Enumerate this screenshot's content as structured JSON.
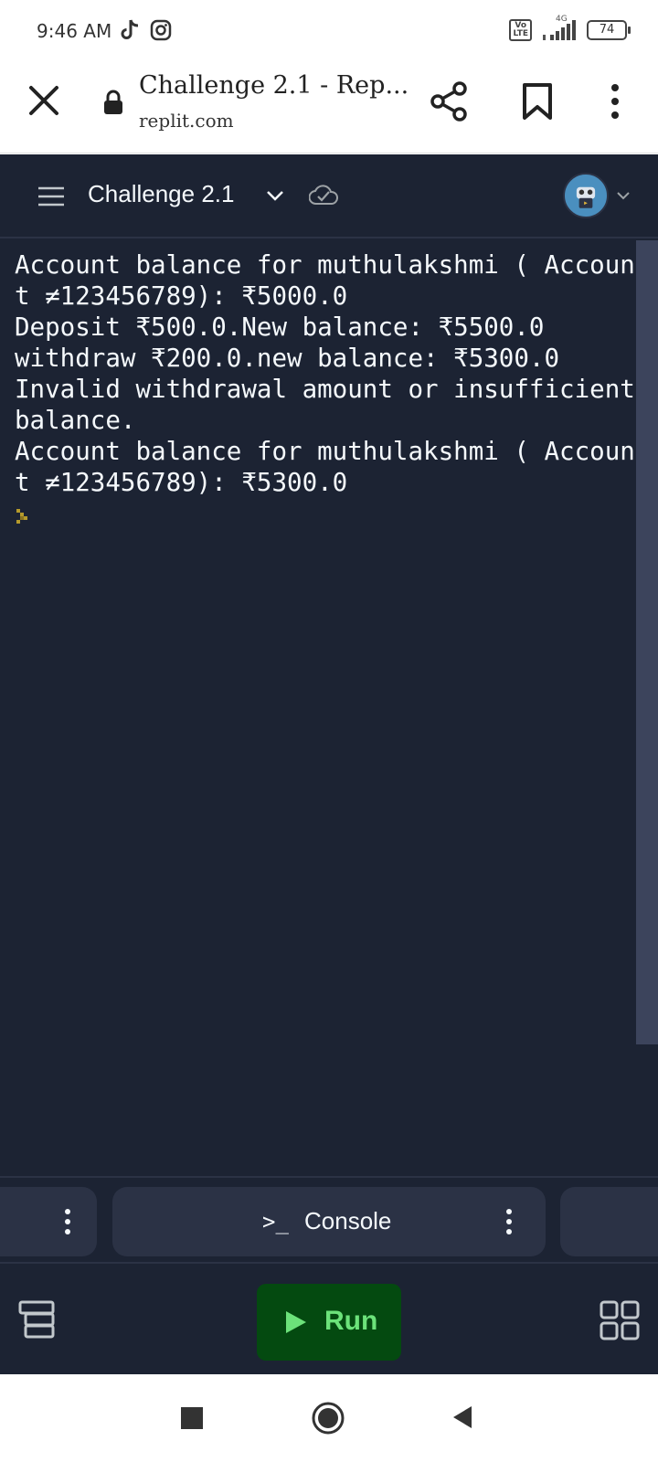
{
  "status_bar": {
    "time": "9:46 AM",
    "volte": "Vo\nLTE",
    "network_type": "4G",
    "battery": "74",
    "icons": [
      "tiktok-icon",
      "instagram-icon",
      "volte-icon",
      "signal-icon",
      "battery-icon"
    ]
  },
  "browser": {
    "title": "Challenge 2.1 - Rep...",
    "domain": "replit.com",
    "icons": [
      "close-icon",
      "lock-icon",
      "share-icon",
      "bookmark-icon",
      "more-vertical-icon"
    ]
  },
  "app_header": {
    "repl_name": "Challenge 2.1",
    "icons": [
      "hamburger-icon",
      "chevron-down-icon",
      "cloud-check-icon",
      "avatar"
    ]
  },
  "console": {
    "output": "Account balance for muthulakshmi ( Account ≠123456789): ₹5000.0\nDeposit ₹500.0.New balance: ₹5500.0\nwithdraw ₹200.0.new balance: ₹5300.0\nInvalid withdrawal amount or insufficient balance.\nAccount balance for muthulakshmi ( Account ≠123456789): ₹5300.0"
  },
  "tabs": {
    "console_prompt": ">_",
    "console_label": "Console"
  },
  "toolbar": {
    "run_label": "Run",
    "run_color": "#044a10",
    "run_text_color": "#6ce27a"
  },
  "colors": {
    "app_bg": "#1c2333",
    "panel": "#2b3245",
    "text": "#f5f9fc"
  }
}
